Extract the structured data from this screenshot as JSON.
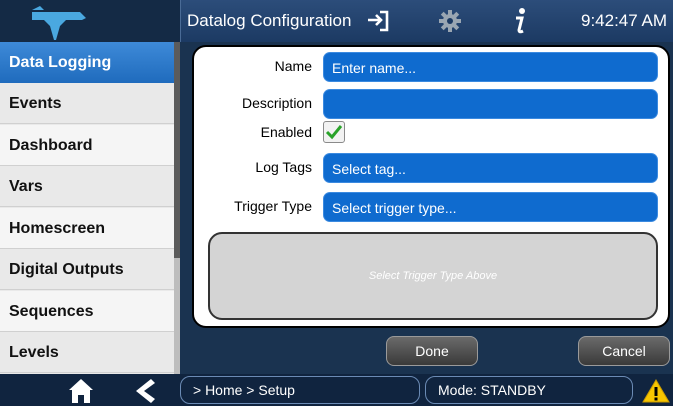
{
  "header": {
    "title": "Datalog Configuration",
    "time": "9:42:47 AM",
    "icons": [
      "teledyne-logo",
      "exit-icon",
      "gear-icon",
      "info-icon"
    ]
  },
  "sidebar": {
    "items": [
      {
        "label": "Data Logging",
        "active": true
      },
      {
        "label": "Events"
      },
      {
        "label": "Dashboard"
      },
      {
        "label": "Vars"
      },
      {
        "label": "Homescreen"
      },
      {
        "label": "Digital Outputs"
      },
      {
        "label": "Sequences"
      },
      {
        "label": "Levels"
      }
    ]
  },
  "form": {
    "name_label": "Name",
    "name_placeholder": "Enter name...",
    "description_label": "Description",
    "description_value": "",
    "enabled_label": "Enabled",
    "enabled_checked": true,
    "log_tags_label": "Log Tags",
    "log_tags_value": "Select tag...",
    "trigger_type_label": "Trigger Type",
    "trigger_type_value": "Select trigger type...",
    "trigger_hint": "Select Trigger Type Above"
  },
  "buttons": {
    "done": "Done",
    "cancel": "Cancel"
  },
  "footer": {
    "breadcrumb": "> Home > Setup",
    "mode": "Mode: STANDBY",
    "icons": [
      "home-icon",
      "back-icon",
      "warning-icon"
    ]
  },
  "colors": {
    "accent": "#0f6bcf",
    "active_tab": "#2a78cc",
    "header": "#1c3a63",
    "warning": "#f7c600",
    "check": "#2aa32a"
  }
}
